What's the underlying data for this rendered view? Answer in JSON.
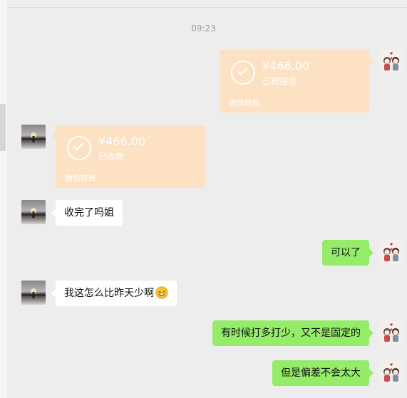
{
  "chat": {
    "timestamp": "09:23",
    "messages": [
      {
        "sender": "self",
        "type": "transfer",
        "amount": "¥466.00",
        "status": "已被接收",
        "source": "微信转账"
      },
      {
        "sender": "other",
        "type": "transfer",
        "amount": "¥466.00",
        "status": "已收款",
        "source": "微信转账"
      },
      {
        "sender": "other",
        "type": "text",
        "text": "收完了吗姐"
      },
      {
        "sender": "self",
        "type": "text",
        "text": "可以了"
      },
      {
        "sender": "other",
        "type": "text",
        "text": "我这怎么比昨天少啊",
        "emoji": "sweat-smile-emoji"
      },
      {
        "sender": "self",
        "type": "text",
        "text": "有时候打多打少，又不是固定的"
      },
      {
        "sender": "self",
        "type": "text",
        "text": "但是偏差不会太大"
      }
    ]
  },
  "colors": {
    "background": "#ededed",
    "transfer_card": "#fde1c3",
    "self_bubble": "#95ec69",
    "other_bubble": "#ffffff",
    "timestamp_text": "#9b9b9b"
  },
  "icons": {
    "transfer_status": "check-circle-icon",
    "self_avatar": "cartoon-couple-avatar",
    "other_avatar": "sunset-figure-avatar"
  }
}
